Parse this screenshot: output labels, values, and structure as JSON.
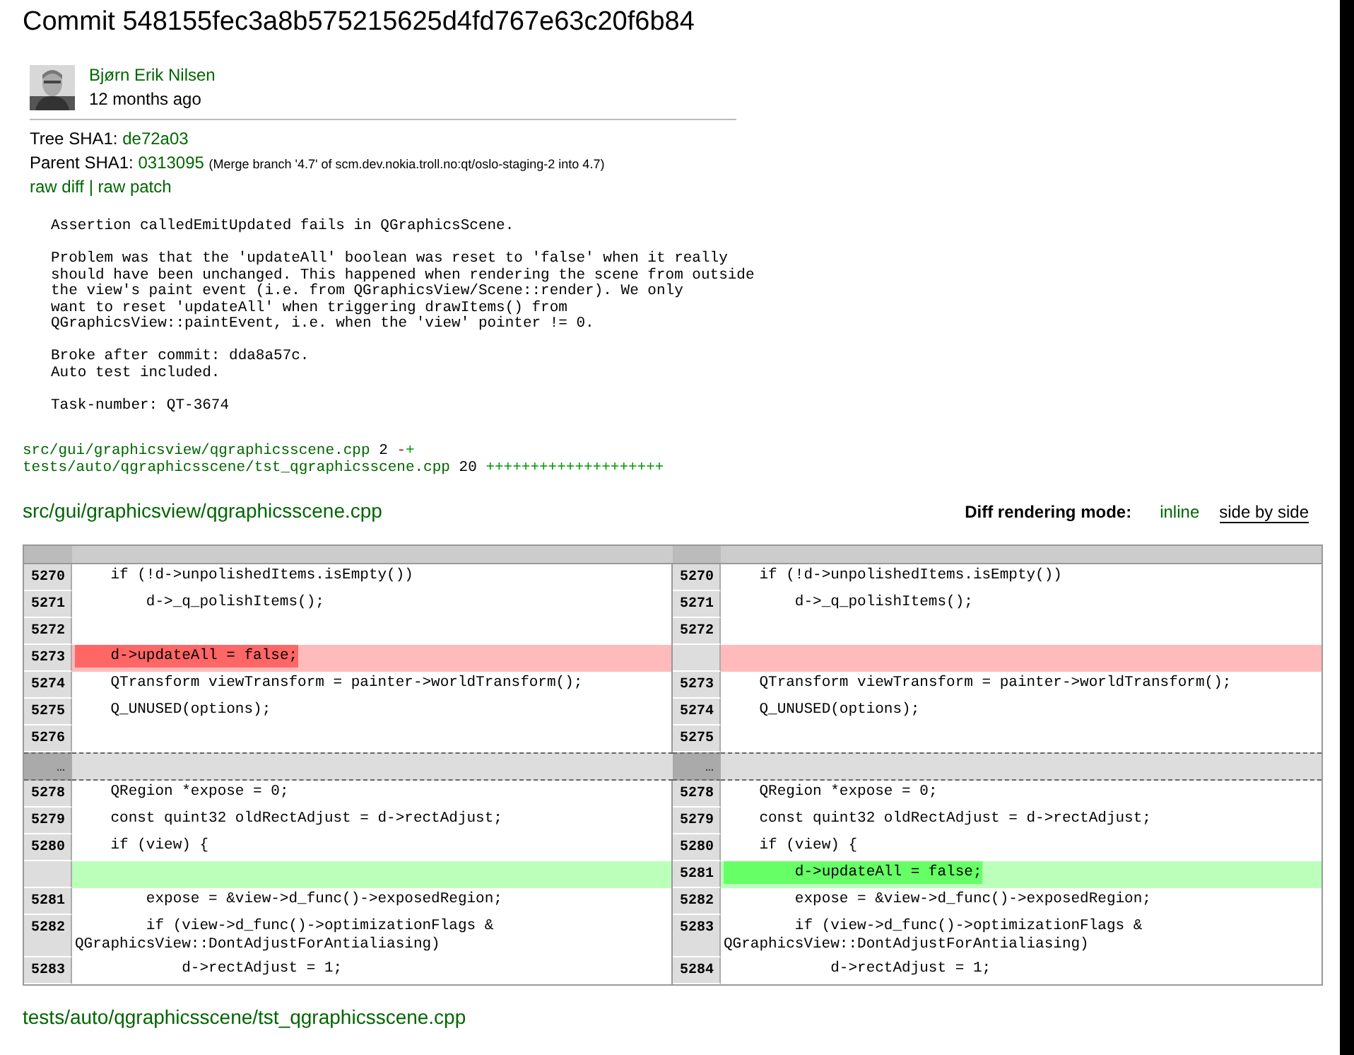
{
  "title": "Commit 548155fec3a8b575215625d4fd767e63c20f6b84",
  "author": {
    "name": "Bjørn Erik Nilsen",
    "time": "12 months ago"
  },
  "tree": {
    "label": "Tree SHA1:",
    "sha": "de72a03"
  },
  "parent": {
    "label": "Parent SHA1:",
    "sha": "0313095",
    "note": "(Merge branch '4.7' of scm.dev.nokia.troll.no:qt/oslo-staging-2 into 4.7)"
  },
  "links": [
    "raw diff",
    "raw patch"
  ],
  "link_separator": "|",
  "message": "Assertion calledEmitUpdated fails in QGraphicsScene.\n\nProblem was that the 'updateAll' boolean was reset to 'false' when it really\nshould have been unchanged. This happened when rendering the scene from outside\nthe view's paint event (i.e. from QGraphicsView/Scene::render). We only\nwant to reset 'updateAll' when triggering drawItems() from\nQGraphicsView::paintEvent, i.e. when the 'view' pointer != 0.\n\nBroke after commit: dda8a57c.\nAuto test included.\n\nTask-number: QT-3674",
  "stats": [
    {
      "path": "src/gui/graphicsview/qgraphicsscene.cpp",
      "count": "2",
      "minus": "-",
      "plus": "+"
    },
    {
      "path": "tests/auto/qgraphicsscene/tst_qgraphicsscene.cpp",
      "count": "20",
      "plus": "++++++++++++++++++++"
    }
  ],
  "file": "src/gui/graphicsview/qgraphicsscene.cpp",
  "mode": {
    "label": "Diff rendering mode:",
    "options": [
      {
        "label": "inline",
        "selected": false
      },
      {
        "label": "side by side",
        "selected": true
      }
    ]
  },
  "diff": [
    {
      "kind": "context",
      "left": {
        "num": "5270",
        "code": "    if (!d->unpolishedItems.isEmpty())"
      },
      "right": {
        "num": "5270",
        "code": "    if (!d->unpolishedItems.isEmpty())"
      }
    },
    {
      "kind": "context",
      "left": {
        "num": "5271",
        "code": "        d->_q_polishItems();"
      },
      "right": {
        "num": "5271",
        "code": "        d->_q_polishItems();"
      }
    },
    {
      "kind": "context",
      "left": {
        "num": "5272"
      },
      "right": {
        "num": "5272"
      }
    },
    {
      "kind": "removed",
      "left": {
        "num": "5273",
        "code": "    d->updateAll = false;"
      }
    },
    {
      "kind": "context",
      "left": {
        "num": "5274",
        "code": "    QTransform viewTransform = painter->worldTransform();"
      },
      "right": {
        "num": "5273",
        "code": "    QTransform viewTransform = painter->worldTransform();"
      }
    },
    {
      "kind": "context",
      "left": {
        "num": "5275",
        "code": "    Q_UNUSED(options);"
      },
      "right": {
        "num": "5274",
        "code": "    Q_UNUSED(options);"
      }
    },
    {
      "kind": "context",
      "left": {
        "num": "5276"
      },
      "right": {
        "num": "5275"
      }
    },
    {
      "kind": "skip",
      "left": {
        "num": "…"
      },
      "right": {
        "num": "…"
      }
    },
    {
      "kind": "context",
      "left": {
        "num": "5278",
        "code": "    QRegion *expose = 0;"
      },
      "right": {
        "num": "5278",
        "code": "    QRegion *expose = 0;"
      }
    },
    {
      "kind": "context",
      "left": {
        "num": "5279",
        "code": "    const quint32 oldRectAdjust = d->rectAdjust;"
      },
      "right": {
        "num": "5279",
        "code": "    const quint32 oldRectAdjust = d->rectAdjust;"
      }
    },
    {
      "kind": "context",
      "left": {
        "num": "5280",
        "code": "    if (view) {"
      },
      "right": {
        "num": "5280",
        "code": "    if (view) {"
      }
    },
    {
      "kind": "added",
      "right": {
        "num": "5281",
        "code": "        d->updateAll = false;"
      }
    },
    {
      "kind": "context",
      "left": {
        "num": "5281",
        "code": "        expose = &view->d_func()->exposedRegion;"
      },
      "right": {
        "num": "5282",
        "code": "        expose = &view->d_func()->exposedRegion;"
      }
    },
    {
      "kind": "context",
      "left": {
        "num": "5282",
        "code": "        if (view->d_func()->optimizationFlags & QGraphicsView::DontAdjustForAntialiasing)"
      },
      "right": {
        "num": "5283",
        "code": "        if (view->d_func()->optimizationFlags & QGraphicsView::DontAdjustForAntialiasing)"
      }
    },
    {
      "kind": "context",
      "left": {
        "num": "5283",
        "code": "            d->rectAdjust = 1;"
      },
      "right": {
        "num": "5284",
        "code": "            d->rectAdjust = 1;"
      }
    }
  ],
  "next_file": "tests/auto/qgraphicsscene/tst_qgraphicsscene.cpp"
}
